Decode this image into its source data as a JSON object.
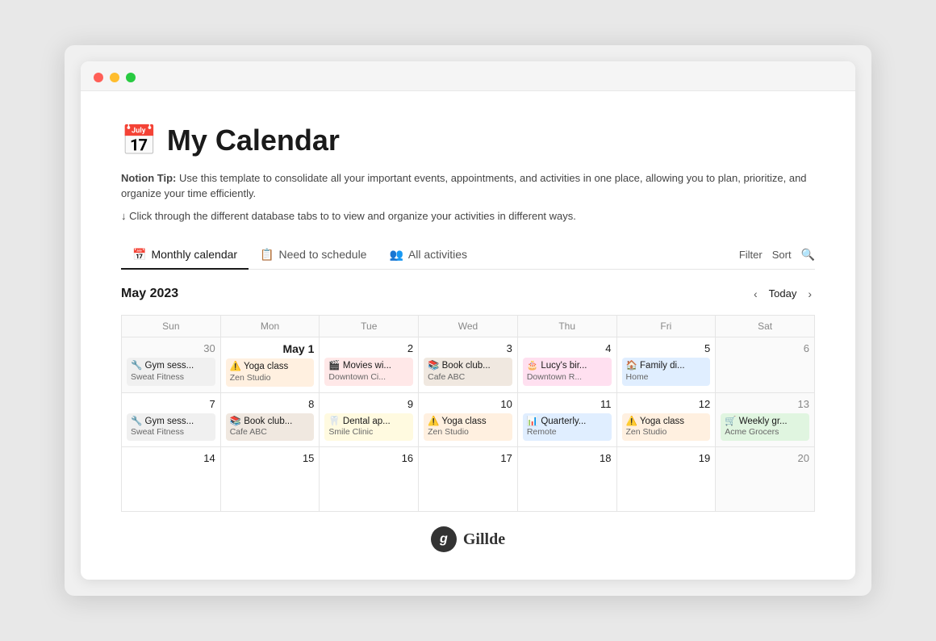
{
  "window": {
    "title": "My Calendar"
  },
  "page": {
    "icon": "📅",
    "title": "My Calendar",
    "tip_label": "Notion Tip:",
    "tip_text": " Use this template to consolidate all your important events, appointments, and activities in one place, allowing you to plan, prioritize, and organize your time efficiently.",
    "click_hint": "↓ Click through the different database tabs to to view and organize your activities in different ways."
  },
  "tabs": [
    {
      "id": "monthly",
      "icon": "📅",
      "label": "Monthly calendar",
      "active": true
    },
    {
      "id": "schedule",
      "icon": "📋",
      "label": "Need to schedule",
      "active": false
    },
    {
      "id": "all",
      "icon": "👥",
      "label": "All activities",
      "active": false
    }
  ],
  "toolbar": {
    "filter": "Filter",
    "sort": "Sort"
  },
  "calendar": {
    "month_title": "May 2023",
    "today_label": "Today",
    "days_of_week": [
      "Sun",
      "Mon",
      "Tue",
      "Wed",
      "Thu",
      "Fri",
      "Sat"
    ],
    "rows": [
      {
        "cells": [
          {
            "date": "30",
            "other": true,
            "events": [
              {
                "emoji": "🔧",
                "title": "Gym sess...",
                "location": "Sweat Fitness",
                "color": "gray"
              }
            ]
          },
          {
            "date": "May 1",
            "may1": true,
            "events": [
              {
                "emoji": "⚠️",
                "title": "Yoga class",
                "location": "Zen Studio",
                "color": "orange"
              }
            ]
          },
          {
            "date": "2",
            "events": [
              {
                "emoji": "🎬",
                "title": "Movies wi...",
                "location": "Downtown Ci...",
                "color": "red"
              }
            ]
          },
          {
            "date": "3",
            "events": [
              {
                "emoji": "📚",
                "title": "Book club...",
                "location": "Cafe ABC",
                "color": "brown"
              }
            ]
          },
          {
            "date": "4",
            "events": [
              {
                "emoji": "🎂",
                "title": "Lucy's bir...",
                "location": "Downtown R...",
                "color": "pink"
              }
            ]
          },
          {
            "date": "5",
            "events": [
              {
                "emoji": "🏠",
                "title": "Family di...",
                "location": "Home",
                "color": "blue"
              }
            ]
          },
          {
            "date": "6",
            "weekend": true,
            "events": []
          }
        ]
      },
      {
        "cells": [
          {
            "date": "7",
            "events": [
              {
                "emoji": "🔧",
                "title": "Gym sess...",
                "location": "Sweat Fitness",
                "color": "gray"
              }
            ]
          },
          {
            "date": "8",
            "events": [
              {
                "emoji": "📚",
                "title": "Book club...",
                "location": "Cafe ABC",
                "color": "brown"
              }
            ]
          },
          {
            "date": "9",
            "events": [
              {
                "emoji": "🦷",
                "title": "Dental ap...",
                "location": "Smile Clinic",
                "color": "yellow"
              }
            ]
          },
          {
            "date": "10",
            "events": [
              {
                "emoji": "⚠️",
                "title": "Yoga class",
                "location": "Zen Studio",
                "color": "orange"
              }
            ]
          },
          {
            "date": "11",
            "events": [
              {
                "emoji": "📊",
                "title": "Quarterly...",
                "location": "Remote",
                "color": "blue"
              }
            ]
          },
          {
            "date": "12",
            "events": [
              {
                "emoji": "⚠️",
                "title": "Yoga class",
                "location": "Zen Studio",
                "color": "orange"
              }
            ]
          },
          {
            "date": "13",
            "weekend": true,
            "events": [
              {
                "emoji": "🛒",
                "title": "Weekly gr...",
                "location": "Acme Grocers",
                "color": "green"
              }
            ]
          }
        ]
      },
      {
        "cells": [
          {
            "date": "14",
            "events": []
          },
          {
            "date": "15",
            "events": []
          },
          {
            "date": "16",
            "events": []
          },
          {
            "date": "17",
            "events": []
          },
          {
            "date": "18",
            "events": []
          },
          {
            "date": "19",
            "events": []
          },
          {
            "date": "20",
            "weekend": true,
            "events": []
          }
        ]
      }
    ]
  },
  "footer": {
    "logo_char": "g",
    "brand_name": "Gillde"
  }
}
